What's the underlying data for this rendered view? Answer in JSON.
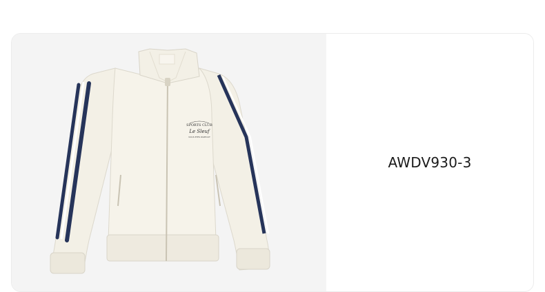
{
  "product": {
    "code": "AWDV930-3",
    "image_alt": "Cream zip-up track jacket with navy and white side stripes",
    "logo_text_line1": "SPORTS CLUB",
    "logo_text_line2": "Le Sleuf",
    "logo_text_line3": "VOUS ETES PARTOUT"
  },
  "colors": {
    "panel_bg": "#f4f4f4",
    "jacket": "#f3f0e6",
    "stripe_navy": "#26345a",
    "text": "#1a1a1a"
  }
}
